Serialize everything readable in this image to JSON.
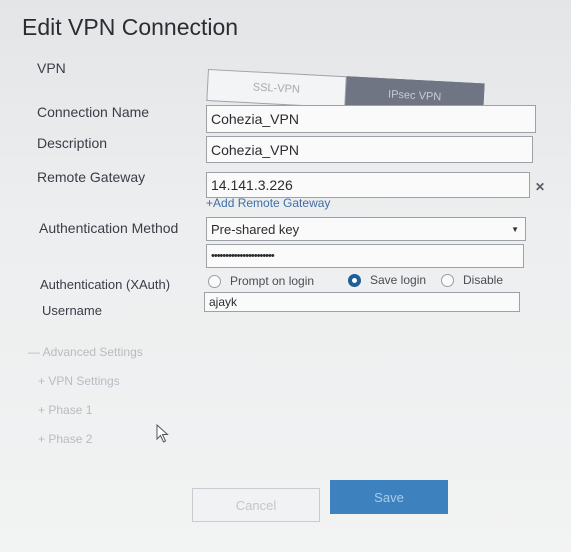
{
  "dialog": {
    "title": "Edit VPN Connection"
  },
  "vpn": {
    "label": "VPN",
    "options": [
      "SSL-VPN",
      "IPsec VPN"
    ],
    "selected": "IPsec VPN"
  },
  "fields": {
    "connection_name": {
      "label": "Connection Name",
      "value": "Cohezia_VPN"
    },
    "description": {
      "label": "Description",
      "value": "Cohezia_VPN"
    },
    "remote_gateway": {
      "label": "Remote Gateway",
      "value": "14.141.3.226",
      "add_link": "Add Remote Gateway"
    },
    "auth_method": {
      "label": "Authentication Method",
      "value": "Pre-shared key"
    },
    "psk": {
      "value": "••••••••••••••••••••••"
    },
    "xauth": {
      "label": "Authentication (XAuth)",
      "options": [
        "Prompt on login",
        "Save login",
        "Disable"
      ],
      "selected": "Save login"
    },
    "username": {
      "label": "Username",
      "value": "ajayk"
    }
  },
  "advanced": {
    "toggle": "Advanced Settings",
    "items": [
      "VPN Settings",
      "Phase 1",
      "Phase 2"
    ]
  },
  "buttons": {
    "cancel": "Cancel",
    "save": "Save"
  },
  "colors": {
    "accent": "#3d82bf",
    "selected_toggle": "#6f7583"
  },
  "icons": {
    "remove_gateway": "close-icon",
    "add_gateway": "plus-icon",
    "dropdown": "chevron-down-icon",
    "cursor": "mouse-pointer-icon"
  }
}
